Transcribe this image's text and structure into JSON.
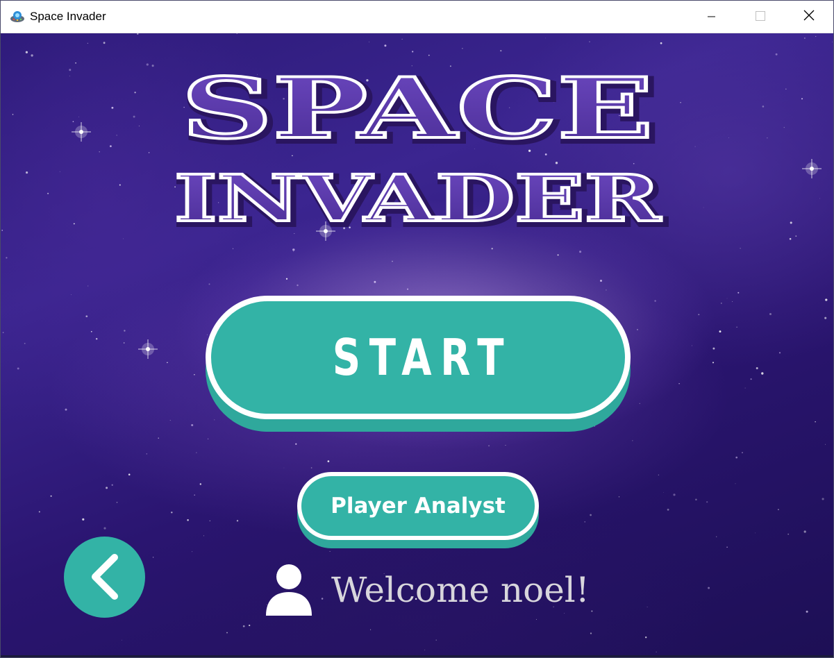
{
  "window": {
    "title": "Space Invader",
    "icon": "alien-ufo-icon",
    "controls": [
      "minimize-icon",
      "maximize-icon",
      "close-icon"
    ]
  },
  "logo": {
    "line1": "SPACE",
    "line2": "INVADER",
    "fill_color": "#5a3aa6",
    "outline_color": "#ffffff"
  },
  "menu": {
    "start_label": "START",
    "analyst_label": "Player Analyst",
    "back_icon": "chevron-left-icon",
    "button_color": "#33b3a6"
  },
  "user": {
    "icon": "user-icon",
    "welcome_text": "Welcome noel!"
  }
}
